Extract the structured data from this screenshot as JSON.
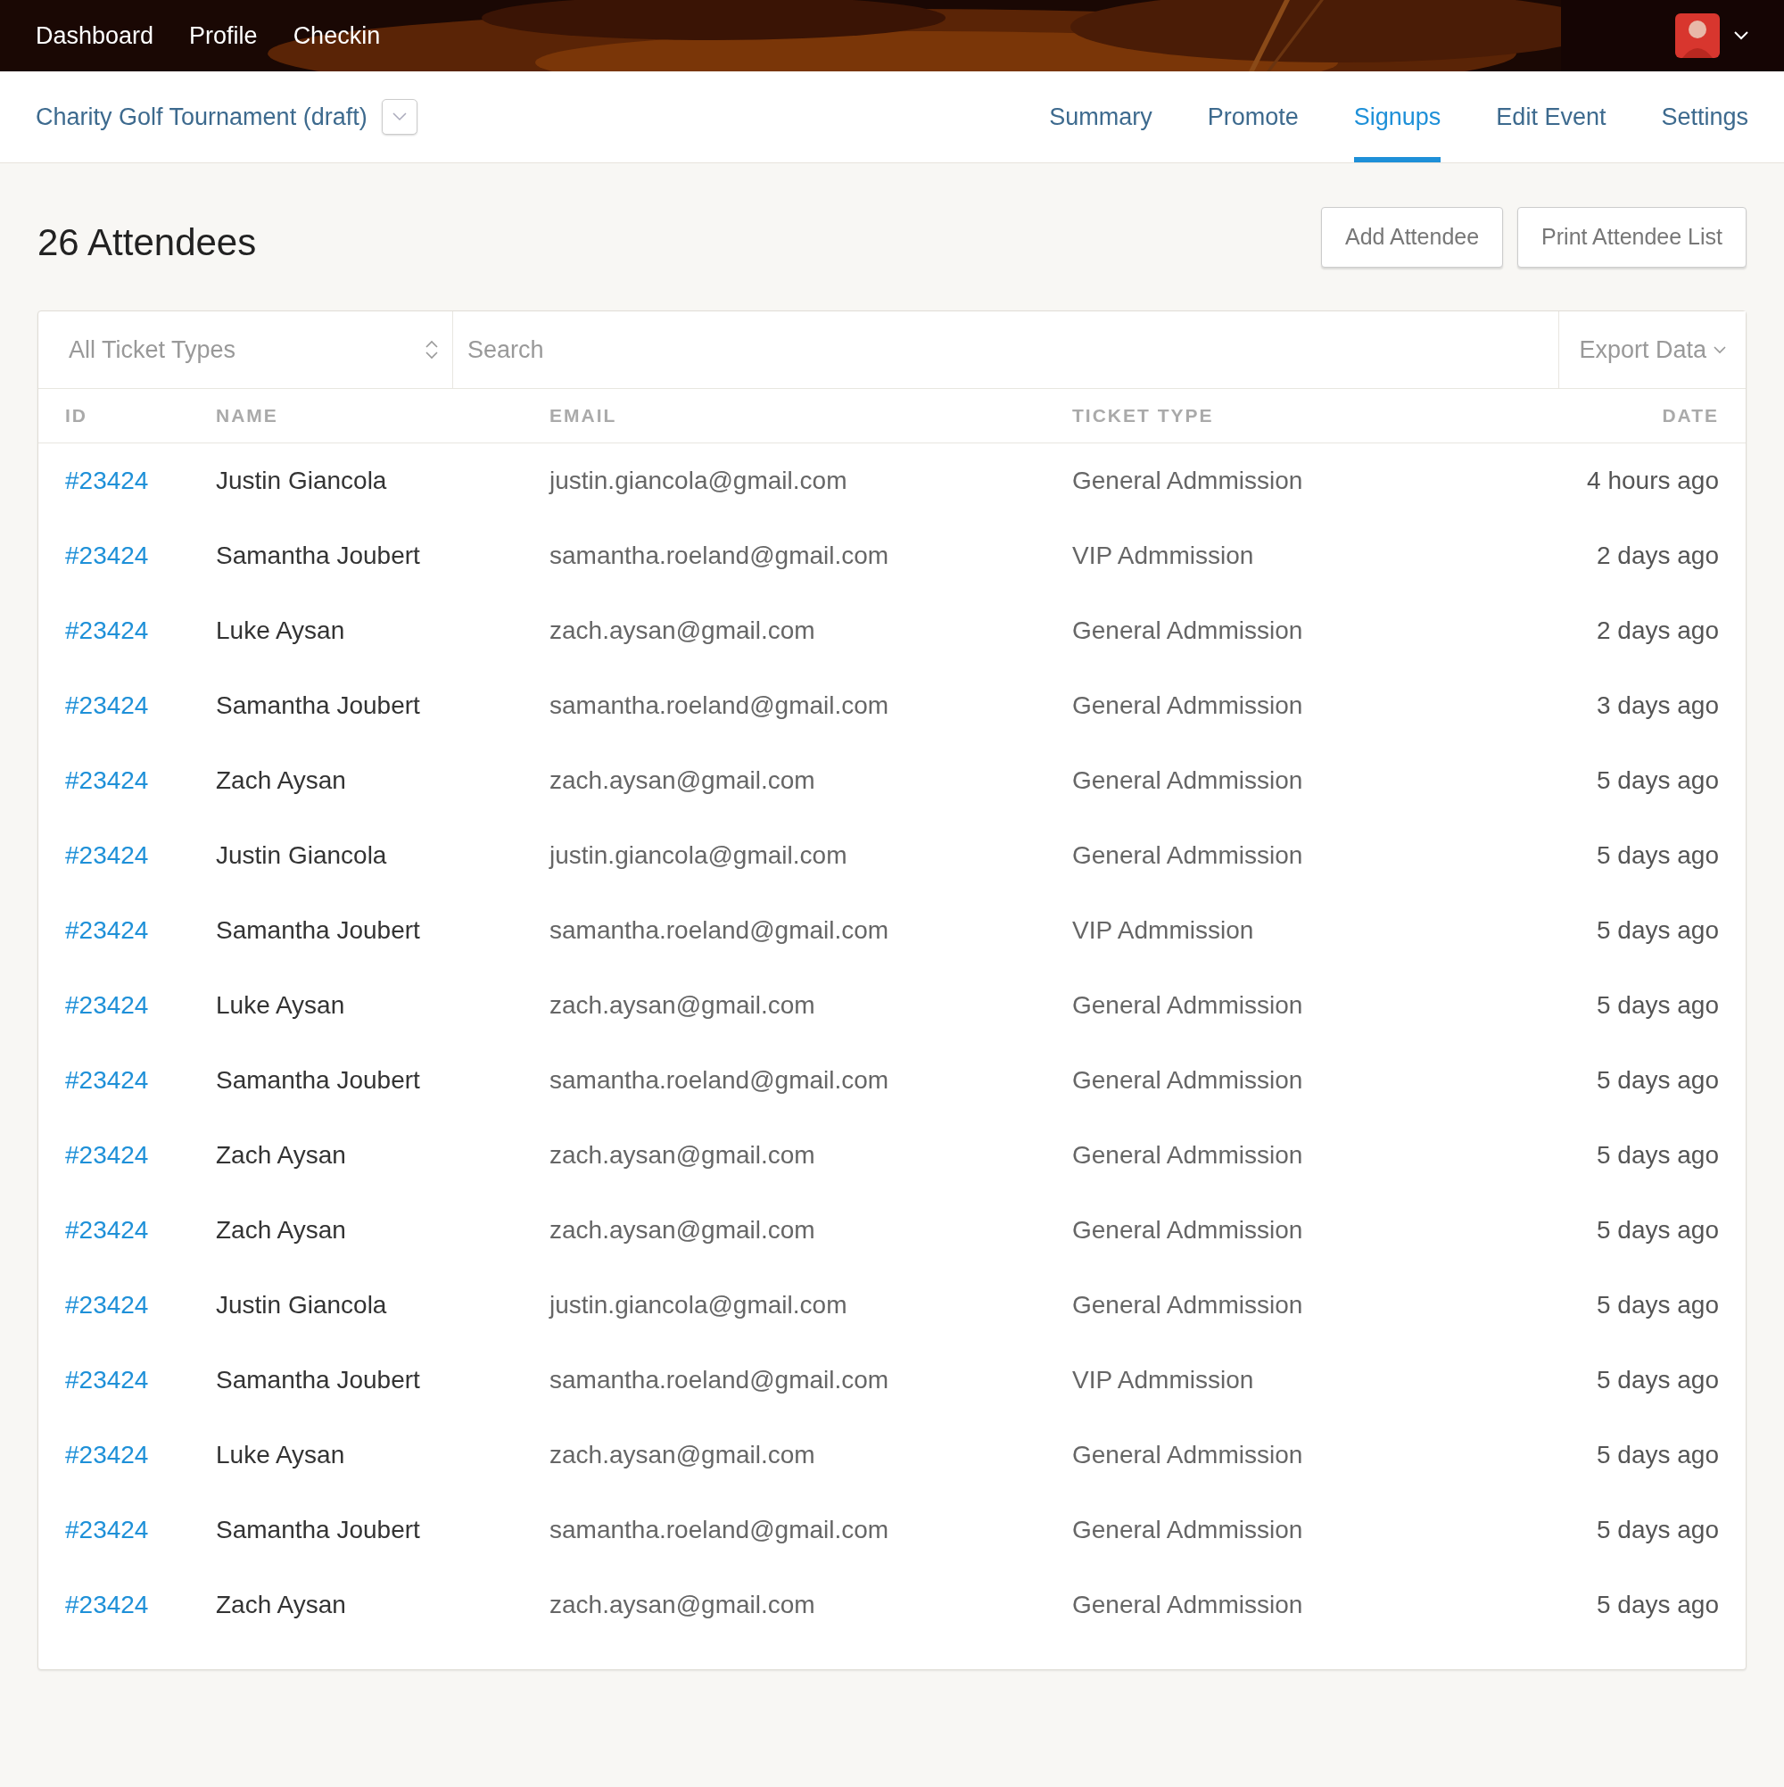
{
  "top_nav": {
    "links": [
      "Dashboard",
      "Profile",
      "Checkin"
    ]
  },
  "event": {
    "title": "Charity Golf Tournament (draft)"
  },
  "tabs": [
    {
      "label": "Summary",
      "selected": false
    },
    {
      "label": "Promote",
      "selected": false
    },
    {
      "label": "Signups",
      "selected": true
    },
    {
      "label": "Edit Event",
      "selected": false
    },
    {
      "label": "Settings",
      "selected": false
    }
  ],
  "heading": "26 Attendees",
  "buttons": [
    "Add Attendee",
    "Print Attendee List"
  ],
  "filters": {
    "ticket_select": "All Ticket Types",
    "search": {
      "placeholder": "Search"
    },
    "export": "Export Data"
  },
  "table": {
    "columns": [
      "ID",
      "NAME",
      "EMAIL",
      "TICKET TYPE",
      "DATE"
    ],
    "rows": [
      [
        "#23424",
        "Justin Giancola",
        "justin.giancola@gmail.com",
        "General Admmission",
        "4 hours ago"
      ],
      [
        "#23424",
        "Samantha Joubert",
        "samantha.roeland@gmail.com",
        "VIP Admmission",
        "2 days ago"
      ],
      [
        "#23424",
        "Luke Aysan",
        "zach.aysan@gmail.com",
        "General Admmission",
        "2 days ago"
      ],
      [
        "#23424",
        "Samantha Joubert",
        "samantha.roeland@gmail.com",
        "General Admmission",
        "3 days ago"
      ],
      [
        "#23424",
        "Zach Aysan",
        "zach.aysan@gmail.com",
        "General Admmission",
        "5 days ago"
      ],
      [
        "#23424",
        "Justin Giancola",
        "justin.giancola@gmail.com",
        "General Admmission",
        "5 days ago"
      ],
      [
        "#23424",
        "Samantha Joubert",
        "samantha.roeland@gmail.com",
        "VIP Admmission",
        "5 days ago"
      ],
      [
        "#23424",
        "Luke Aysan",
        "zach.aysan@gmail.com",
        "General Admmission",
        "5 days ago"
      ],
      [
        "#23424",
        "Samantha Joubert",
        "samantha.roeland@gmail.com",
        "General Admmission",
        "5 days ago"
      ],
      [
        "#23424",
        "Zach Aysan",
        "zach.aysan@gmail.com",
        "General Admmission",
        "5 days ago"
      ],
      [
        "#23424",
        "Zach Aysan",
        "zach.aysan@gmail.com",
        "General Admmission",
        "5 days ago"
      ],
      [
        "#23424",
        "Justin Giancola",
        "justin.giancola@gmail.com",
        "General Admmission",
        "5 days ago"
      ],
      [
        "#23424",
        "Samantha Joubert",
        "samantha.roeland@gmail.com",
        "VIP Admmission",
        "5 days ago"
      ],
      [
        "#23424",
        "Luke Aysan",
        "zach.aysan@gmail.com",
        "General Admmission",
        "5 days ago"
      ],
      [
        "#23424",
        "Samantha Joubert",
        "samantha.roeland@gmail.com",
        "General Admmission",
        "5 days ago"
      ],
      [
        "#23424",
        "Zach Aysan",
        "zach.aysan@gmail.com",
        "General Admmission",
        "5 days ago"
      ]
    ]
  }
}
